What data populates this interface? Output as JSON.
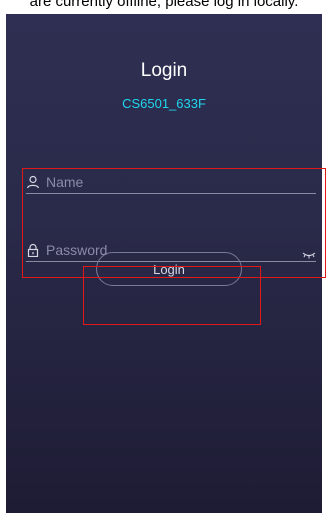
{
  "top_cut_text": "are currently offline, please log in locally.",
  "login": {
    "title": "Login",
    "device_name": "CS6501_633F",
    "name_placeholder": "Name",
    "password_placeholder": "Password",
    "login_button": "Login"
  },
  "icons": {
    "name": "user-icon",
    "password": "lock-icon",
    "visibility": "eye-closed-icon"
  },
  "colors": {
    "accent": "#1fd6ee",
    "highlight": "#e01818",
    "background_top": "#2e2f52",
    "background_bottom": "#1e1c34"
  }
}
